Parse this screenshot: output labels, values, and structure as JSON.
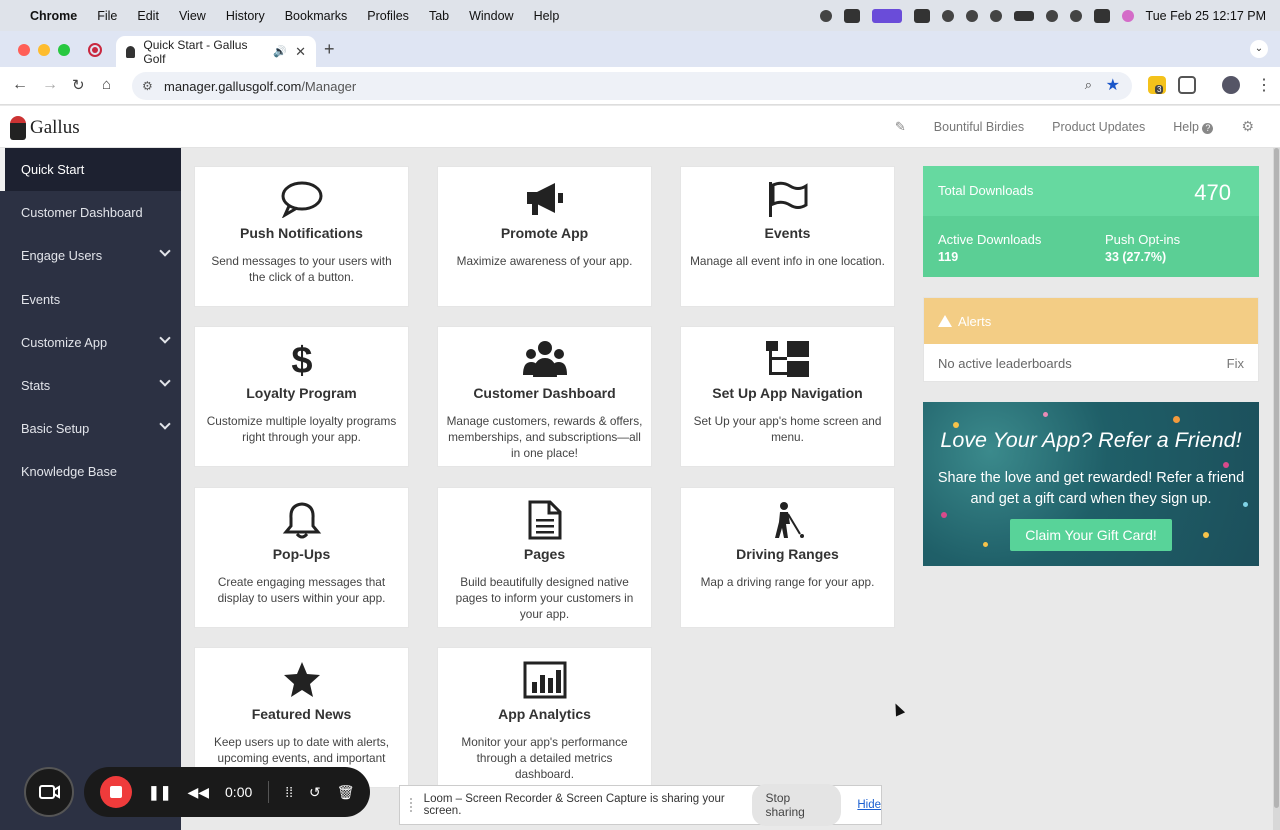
{
  "macmenu": {
    "items": [
      "Chrome",
      "File",
      "Edit",
      "View",
      "History",
      "Bookmarks",
      "Profiles",
      "Tab",
      "Window",
      "Help"
    ],
    "datetime": "Tue Feb 25  12:17 PM"
  },
  "browser": {
    "tab_title": "Quick Start - Gallus Golf",
    "url_domain": "manager.gallusgolf.com",
    "url_path": "/Manager",
    "ext_badge": "3"
  },
  "app": {
    "logo_text": "Gallus",
    "header_links": [
      "Bountiful Birdies",
      "Product Updates",
      "Help"
    ]
  },
  "sidebar": {
    "items": [
      {
        "label": "Quick Start"
      },
      {
        "label": "Customer Dashboard"
      },
      {
        "label": "Engage Users"
      },
      {
        "label": "Events"
      },
      {
        "label": "Customize App"
      },
      {
        "label": "Stats"
      },
      {
        "label": "Basic Setup"
      },
      {
        "label": "Knowledge Base"
      }
    ]
  },
  "cards": [
    {
      "title": "Push Notifications",
      "desc": "Send messages to your users with the click of a button.",
      "icon": "speech-bubble-icon"
    },
    {
      "title": "Promote App",
      "desc": "Maximize awareness of your app.",
      "icon": "megaphone-icon"
    },
    {
      "title": "Events",
      "desc": "Manage all event info in one location.",
      "icon": "flag-icon"
    },
    {
      "title": "Loyalty Program",
      "desc": "Customize multiple loyalty programs right through your app.",
      "icon": "dollar-icon"
    },
    {
      "title": "Customer Dashboard",
      "desc": "Manage customers, rewards & offers, memberships, and subscriptions—all in one place!",
      "icon": "users-icon"
    },
    {
      "title": "Set Up App Navigation",
      "desc": "Set Up your app's home screen and menu.",
      "icon": "sitemap-icon"
    },
    {
      "title": "Pop-Ups",
      "desc": "Create engaging messages that display to users within your app.",
      "icon": "bell-icon"
    },
    {
      "title": "Pages",
      "desc": "Build beautifully designed native pages to inform your customers in your app.",
      "icon": "document-icon"
    },
    {
      "title": "Driving Ranges",
      "desc": "Map a driving range for your app.",
      "icon": "golfer-icon"
    },
    {
      "title": "Featured News",
      "desc": "Keep users up to date with alerts, upcoming events, and important",
      "icon": "star-icon"
    },
    {
      "title": "App Analytics",
      "desc": "Monitor your app's performance through a detailed metrics dashboard.",
      "icon": "bar-chart-icon"
    }
  ],
  "stats": {
    "total_label": "Total Downloads",
    "total_value": "470",
    "active_label": "Active Downloads",
    "active_value": "119",
    "optin_label": "Push Opt-ins",
    "optin_value": "33 (27.7%)"
  },
  "alerts": {
    "title": "Alerts",
    "message": "No active leaderboards",
    "action": "Fix"
  },
  "promo": {
    "heading": "Love Your App? Refer a Friend!",
    "text": "Share the love and get rewarded! Refer a friend and get a gift card when they sign up.",
    "button": "Claim Your Gift Card!"
  },
  "loom": {
    "timer": "0:00",
    "share_msg": "Loom – Screen Recorder & Screen Capture is sharing your screen.",
    "stop_label": "Stop sharing",
    "hide_label": "Hide"
  },
  "colors": {
    "sidebar": "#2c3143",
    "stats_green": "#66d9a0",
    "alert_yellow": "#f3cd85",
    "promo_teal": "#1f5f68",
    "loom_red": "#ef3b3b"
  }
}
